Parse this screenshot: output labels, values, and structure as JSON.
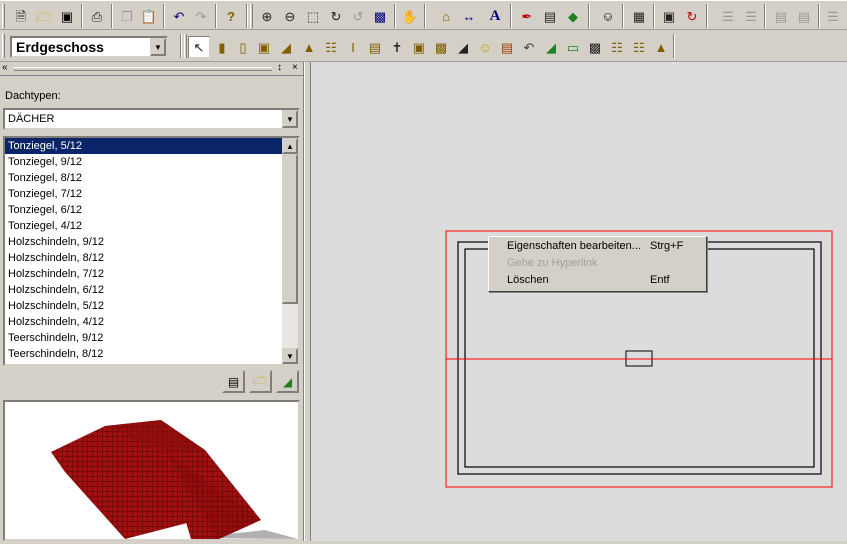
{
  "toolbar": {
    "floor_select": "Erdgeschoss"
  },
  "panel": {
    "label": "Dachtypen:",
    "category": "DÄCHER",
    "items": [
      "Tonziegel, 5/12",
      "Tonziegel, 9/12",
      "Tonziegel, 8/12",
      "Tonziegel, 7/12",
      "Tonziegel, 6/12",
      "Tonziegel, 4/12",
      "Holzschindeln, 9/12",
      "Holzschindeln, 8/12",
      "Holzschindeln, 7/12",
      "Holzschindeln, 6/12",
      "Holzschindeln, 5/12",
      "Holzschindeln, 4/12",
      "Teerschindeln, 9/12",
      "Teerschindeln, 8/12"
    ],
    "selected_index": 0
  },
  "context_menu": {
    "items": [
      {
        "label": "Eigenschaften bearbeiten...",
        "shortcut": "Strg+F",
        "enabled": true
      },
      {
        "label": "Gehe zu Hyperlink",
        "shortcut": "",
        "enabled": false
      },
      {
        "label": "Löschen",
        "shortcut": "Entf",
        "enabled": true
      }
    ]
  },
  "colors": {
    "selection": "#0a246a",
    "roof": "#a01010",
    "selection_box": "#ff0000"
  }
}
